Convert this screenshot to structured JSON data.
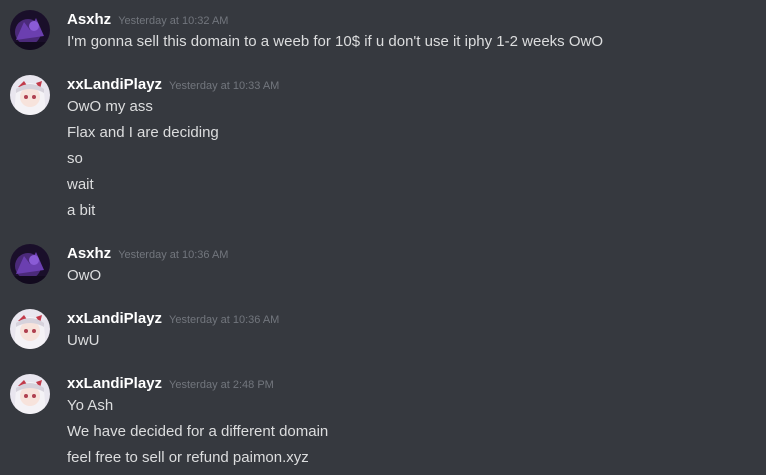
{
  "messages": [
    {
      "author": "Asxhz",
      "timestamp": "Yesterday at 10:32 AM",
      "avatar": "purple-dark-avatar",
      "lines": [
        "I'm gonna sell this domain to a weeb for 10$ if u don't use it iphy 1-2 weeks OwO"
      ]
    },
    {
      "author": "xxLandiPlayz",
      "timestamp": "Yesterday at 10:33 AM",
      "avatar": "anime-girl-avatar",
      "lines": [
        "OwO my ass",
        "Flax and I are deciding",
        "so",
        "wait",
        "a bit"
      ]
    },
    {
      "author": "Asxhz",
      "timestamp": "Yesterday at 10:36 AM",
      "avatar": "purple-dark-avatar",
      "lines": [
        "OwO"
      ]
    },
    {
      "author": "xxLandiPlayz",
      "timestamp": "Yesterday at 10:36 AM",
      "avatar": "anime-girl-avatar",
      "lines": [
        "UwU"
      ]
    },
    {
      "author": "xxLandiPlayz",
      "timestamp": "Yesterday at 2:48 PM",
      "avatar": "anime-girl-avatar",
      "lines": [
        "Yo Ash",
        "We have decided for a different domain",
        "feel free to sell or refund paimon.xyz"
      ]
    }
  ],
  "colors": {
    "background": "#36393f",
    "username": "#ffffff",
    "timestamp": "#72767d",
    "message_text": "#dcddde"
  }
}
